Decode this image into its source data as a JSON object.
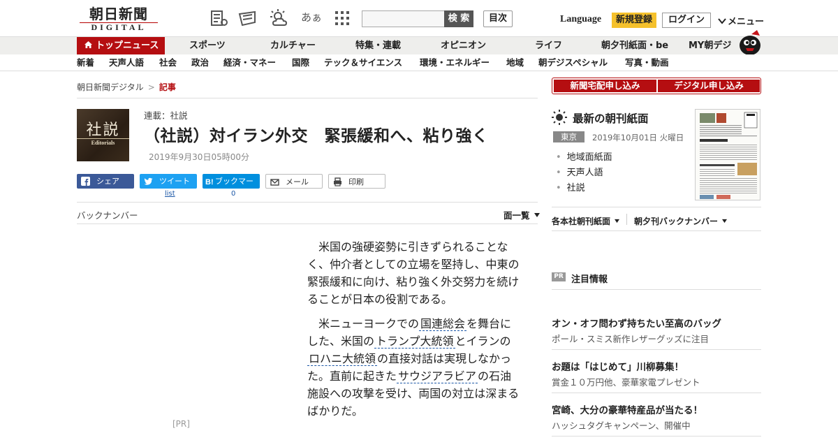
{
  "header": {
    "logo_jp": "朝日新聞",
    "logo_en": "DIGITAL",
    "font_size_glyph": "あぁ",
    "search_button": "検 索",
    "search_placeholder": "",
    "contents_button": "目次",
    "language": "Language",
    "register": "新規登録",
    "login": "ログイン",
    "menu": "メニュー"
  },
  "nav_primary": [
    "トップニュース",
    "スポーツ",
    "カルチャー",
    "特集・連載",
    "オピニオン",
    "ライフ",
    "朝夕刊紙面・be",
    "MY朝デジ"
  ],
  "nav_secondary": [
    "新着",
    "天声人語",
    "社会",
    "政治",
    "経済・マネー",
    "国際",
    "テック＆サイエンス",
    "環境・エネルギー",
    "地域",
    "朝デジスペシャル",
    "写真・動画"
  ],
  "breadcrumb": {
    "home": "朝日新聞デジタル",
    "separator": ">",
    "current": "記事"
  },
  "article": {
    "thumb_jp": "社説",
    "thumb_en": "Editorials",
    "series": "連載：社説",
    "title": "（社説）対イラン外交　緊張緩和へ、粘り強く",
    "date": "2019年9月30日05時00分",
    "share": {
      "facebook": "シェア",
      "twitter": "ツイート",
      "twitter_count": "list",
      "hatena": "ブックマーク",
      "hatena_count": "0",
      "mail": "メール",
      "print": "印刷"
    },
    "back_number": "バックナンバー",
    "page_list": "面一覧",
    "pr": "[PR]",
    "paragraph1": "米国の強硬姿勢に引きずられることなく、仲介者としての立場を堅持し、中東の緊張緩和に向け、粘り強く外交努力を続けることが日本の役割である。",
    "p2_a": "米ニューヨークでの",
    "p2_link1": "国連総会",
    "p2_b": "を舞台にした、米国の",
    "p2_link2": "トランプ大統領",
    "p2_c": "とイランの",
    "p2_link3": "ロハニ大統領",
    "p2_d": "の直接対話は実現しなかった。直前に起きた",
    "p2_link4": "サウジアラビア",
    "p2_e": "の石油施設への攻撃を受け、両国の対立は深まるばかりだ。"
  },
  "sidebar": {
    "apply_delivery": "新聞宅配申し込み",
    "apply_digital": "デジタル申し込み",
    "paper_title": "最新の朝刊紙面",
    "region": "東京",
    "paper_date": "2019年10月01日 火曜日",
    "links": [
      "地域面紙面",
      "天声人語",
      "社説"
    ],
    "dropdown1": "各本社朝刊紙面",
    "dropdown2": "朝夕刊バックナンバー",
    "pr_badge": "PR",
    "pr_title": "注目情報",
    "pr_items": [
      {
        "headline": "オン・オフ問わず持ちたい至高のバッグ",
        "sub": "ポール・スミス新作レザーグッズに注目"
      },
      {
        "headline": "お題は「はじめて」川柳募集！",
        "sub": "賞金１０万円他、豪華家電プレゼント"
      },
      {
        "headline": "宮崎、大分の豪華特産品が当たる！",
        "sub": "ハッシュタグキャンペーン、開催中"
      }
    ]
  },
  "colors": {
    "brand_red": "#b50e11",
    "register_yellow": "#f5c12c",
    "facebook": "#3b5998",
    "twitter": "#1da1f2",
    "hatena": "#008fde"
  }
}
